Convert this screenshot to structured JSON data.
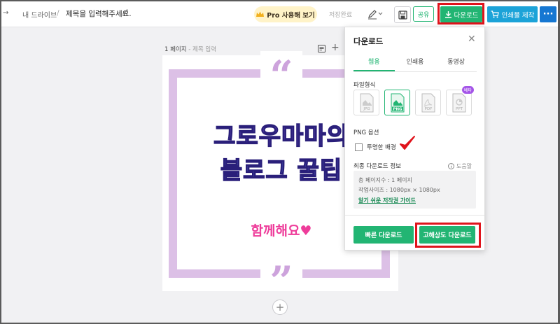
{
  "header": {
    "back": "→",
    "breadcrumb": "내 드라이브",
    "separator": "/",
    "doc_title": "제목을 입력해주세요.",
    "pro_label": "Pro 사용해 보기",
    "save_status": "저장완료",
    "share_label": "공유",
    "download_label": "다운로드",
    "print_label": "인쇄물 제작",
    "more_label": "···"
  },
  "canvas": {
    "page_label": "1 페이지",
    "page_sub": " - 제목 입력",
    "add_top": "+",
    "quote_open": "“",
    "quote_close": "”",
    "headline_1": "그로우마마의",
    "headline_2": "블로그 꿀팁",
    "subline": "함께해요♥",
    "add_page": "+"
  },
  "panel": {
    "title": "다운로드",
    "close": "✕",
    "tabs": [
      "웹용",
      "인쇄용",
      "동영상"
    ],
    "file_format_label": "파일형식",
    "formats": [
      "JPG",
      "PNG",
      "PDF",
      "PPT"
    ],
    "beta_badge": "베타",
    "png_options_label": "PNG 옵션",
    "transparent_bg": "투명한 배경",
    "final_info_label": "최종 다운로드 정보",
    "help": "도움말",
    "info_pages": "총 페이지수 : 1 페이지",
    "info_size": "작업사이즈 : 1080px × 1080px",
    "info_link": "알기 쉬운 저작권 가이드",
    "fast_download": "빠른 다운로드",
    "hq_download": "고해상도 다운로드"
  },
  "colors": {
    "accent": "#22b573",
    "annotation_red": "#e0141c",
    "frame": "#dcc0e6"
  }
}
